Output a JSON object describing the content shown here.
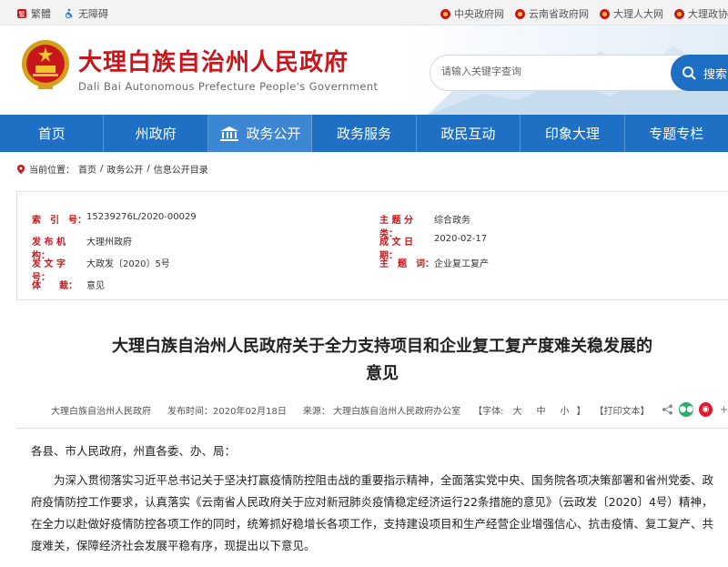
{
  "topbar": {
    "traditional": "繁體",
    "accessibility": "无障碍",
    "links": [
      "中央政府网",
      "云南省政府网",
      "大理人大网",
      "大理政协"
    ]
  },
  "header": {
    "title_zh": "大理白族自治州人民政府",
    "title_en": "Dali Bai Autonomous Prefecture People's Government",
    "search_placeholder": "请输入关键字查询",
    "search_button": "搜索"
  },
  "nav": [
    "首页",
    "州政府",
    "政务公开",
    "政务服务",
    "政民互动",
    "印象大理",
    "专题专栏"
  ],
  "breadcrumb": {
    "prefix": "当前位置：",
    "items": [
      "首页",
      "政务公开",
      "信息公开目录"
    ],
    "sep": "/"
  },
  "meta": {
    "index_label": "索　引　号：",
    "index_value": "15239276L/2020-00029",
    "topic_label": "主 题 分 类：",
    "topic_value": "综合政务",
    "issuer_label": "发 布 机 构：",
    "issuer_value": "大理州政府",
    "date_label": "成 文 日 期：",
    "date_value": "2020-02-17",
    "docno_label": "发 文 字 号：",
    "docno_value": "大政发〔2020〕5号",
    "keywords_label": "主　题　词：",
    "keywords_value": "企业复工复产",
    "genre_label": "体　　裁：",
    "genre_value": "意见"
  },
  "article": {
    "title_line1": "大理白族自治州人民政府关于全力支持项目和企业复工复产度难关稳发展的",
    "title_line2": "意见",
    "author": "大理白族自治州人民政府",
    "publish_time": "发布时间：2020年02月18日",
    "source": "来源：  大理白族自治州人民政府办公室",
    "font_label": "【字体:",
    "font_large": "大",
    "font_medium": "中",
    "font_small": "小",
    "font_close": "】",
    "print": "【打印文本】",
    "greeting": "各县、市人民政府，州直各委、办、局：",
    "para1": "为深入贯彻落实习近平总书记关于坚决打赢疫情防控阻击战的重要指示精神，全面落实党中央、国务院各项决策部署和省州党委、政府疫情防控工作要求，认真落实《云南省人民政府关于应对新冠肺炎疫情稳定经济运行22条措施的意见》（云政发〔2020〕4号）精神，在全力以赴做好疫情防控各项工作的同时，统筹抓好稳增长各项工作，支持建设项目和生产经营企业增强信心、抗击疫情、复工复产、共度难关，保障经济社会发展平稳有序，现提出以下意见。"
  },
  "colors": {
    "brand_red": "#c8161d",
    "nav_blue": "#1f70c5"
  }
}
